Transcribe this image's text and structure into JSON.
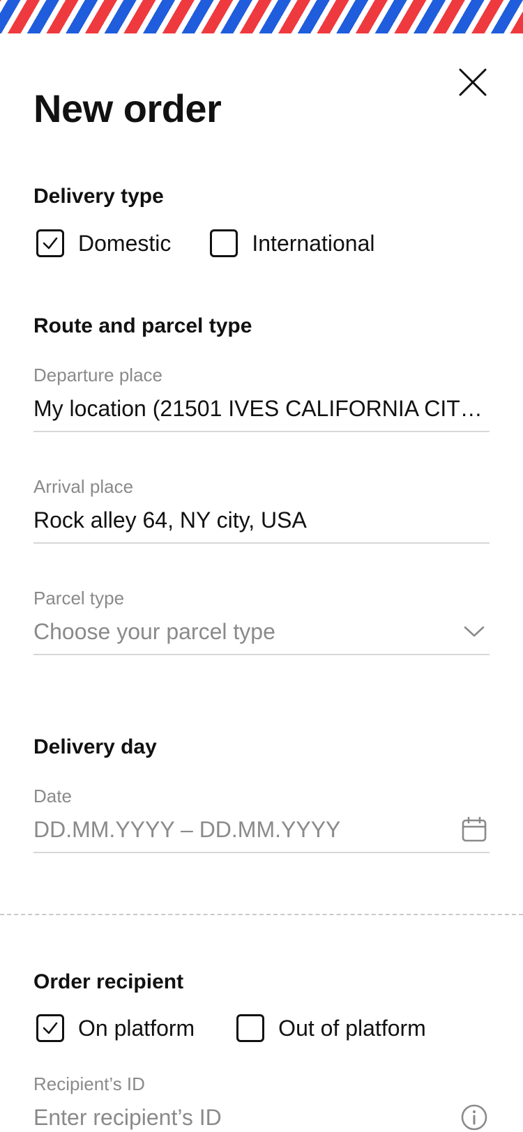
{
  "header": {
    "title": "New order",
    "close_icon": "close-icon"
  },
  "delivery_type": {
    "title": "Delivery type",
    "options": [
      {
        "label": "Domestic",
        "checked": true
      },
      {
        "label": "International",
        "checked": false
      }
    ]
  },
  "route": {
    "title": "Route and parcel type",
    "departure": {
      "label": "Departure place",
      "value": "My location (21501 IVES CALIFORNIA CITY..."
    },
    "arrival": {
      "label": "Arrival place",
      "value": "Rock alley 64, NY city, USA"
    },
    "parcel_type": {
      "label": "Parcel type",
      "placeholder": "Choose your parcel type",
      "icon": "chevron-down-icon"
    }
  },
  "delivery_day": {
    "title": "Delivery day",
    "date": {
      "label": "Date",
      "placeholder": "DD.MM.YYYY – DD.MM.YYYY",
      "icon": "calendar-icon"
    }
  },
  "recipient": {
    "title": "Order recipient",
    "options": [
      {
        "label": "On platform",
        "checked": true
      },
      {
        "label": "Out of platform",
        "checked": false
      }
    ],
    "recipient_id": {
      "label": "Recipient’s ID",
      "placeholder": "Enter recipient’s ID",
      "icon": "info-icon"
    }
  },
  "colors": {
    "stripe_red": "#ee3a3f",
    "stripe_blue": "#1f5ddc",
    "text": "#111111",
    "muted": "#8a8a8a",
    "divider": "#d7d7d7"
  }
}
